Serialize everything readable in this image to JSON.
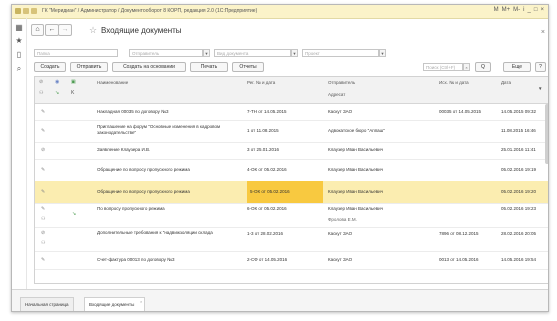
{
  "app": {
    "title": "ГК \"Меридиан\" / Администратор / Документооборот 8 КОРП, редакция 2.0   (1С:Предприятие)",
    "window_controls": [
      "M",
      "M+",
      "M-",
      "i",
      "_",
      "□",
      "×"
    ]
  },
  "nav": {
    "home_label": "⌂",
    "back_label": "←",
    "forward_label": "→",
    "star": "☆",
    "page_title": "Входящие документы",
    "close": "×"
  },
  "sidebar": {
    "icons": [
      "apps-grid-icon",
      "star-icon",
      "history-icon",
      "search-icon"
    ]
  },
  "filters": {
    "folder_placeholder": "Папка",
    "sender_placeholder": "Отправитель",
    "view_placeholder": "Вид документа",
    "project_placeholder": "Проект"
  },
  "toolbar": {
    "create": "Создать",
    "send": "Отправить",
    "create_based_on": "Создать на основании",
    "print": "Печать",
    "reports": "Отчеты",
    "search_placeholder": "Поиск (Ctrl+F)",
    "search_clear": "×",
    "search_btn": "Q",
    "more": "Еще",
    "help": "?"
  },
  "table": {
    "headers": {
      "name": "Наименование",
      "reg": "Рег. № и дата",
      "sender": "Отправитель",
      "addressee": "Адресат",
      "out": "Исх. № и дата",
      "date": "Дата"
    },
    "rows": [
      {
        "name": "Накладная 00035 по договору №3",
        "reg": "7-ТН от 14.05.2015",
        "sender": "Каскут ЗАО",
        "sub": "",
        "out": "00035 от 14.05.2015",
        "date": "14.05.2015 09:32",
        "selected": false
      },
      {
        "name": "Приглашение на форум \"Основные изменения в кадровом законодательстве\"",
        "reg": "1 от 11.08.2015",
        "sender": "Адвокатское бюро \"Аппаш\"",
        "sub": "",
        "out": "",
        "date": "11.08.2015 16:46",
        "selected": false
      },
      {
        "name": "Заявление Клаузера И.В.",
        "reg": "3 от 25.01.2016",
        "sender": "Клаузер Иван Васильевич",
        "sub": "",
        "out": "",
        "date": "25.01.2016 11:41",
        "selected": false
      },
      {
        "name": "Обращение по вопросу пропускного режима",
        "reg": "4-ОК от 05.02.2016",
        "sender": "Клаузер Иван Васильевич",
        "sub": "",
        "out": "",
        "date": "05.02.2016 19:19",
        "selected": false
      },
      {
        "name": "Обращение по вопросу пропускного режима",
        "reg": "5-ОК от 05.02.2016",
        "sender": "Клаузер Иван Васильевич",
        "sub": "",
        "out": "",
        "date": "05.02.2016 19:20",
        "selected": true
      },
      {
        "name": "По вопросу пропускного режима",
        "reg": "6-ОК от 05.02.2016",
        "sender": "Клаузер Иван Васильевич",
        "sub": "Фролова Е.М.",
        "out": "",
        "date": "05.02.2016 19:23",
        "selected": false
      },
      {
        "name": "Дополнительные требования к \"надвижзоляции склада",
        "reg": "1-3 от 28.02.2016",
        "sender": "Каскут ЗАО",
        "sub": "",
        "out": "7896 от 08.12.2015",
        "date": "28.02.2016 20:05",
        "selected": false
      },
      {
        "name": "Счет-фактура 00013 по договору №3",
        "reg": "2-СФ от 14.05.2016",
        "sender": "Каскут ЗАО",
        "sub": "",
        "out": "0013 от 14.05.2016",
        "date": "14.05.2016 19:54",
        "selected": false
      }
    ]
  },
  "bottom_tabs": {
    "home": "Начальная страница",
    "incoming": "Входящие документы",
    "close": "×"
  },
  "colors": {
    "selection": "#f8c940",
    "selected_row": "#fbedb0",
    "titlebar": "#fbf3c9"
  }
}
